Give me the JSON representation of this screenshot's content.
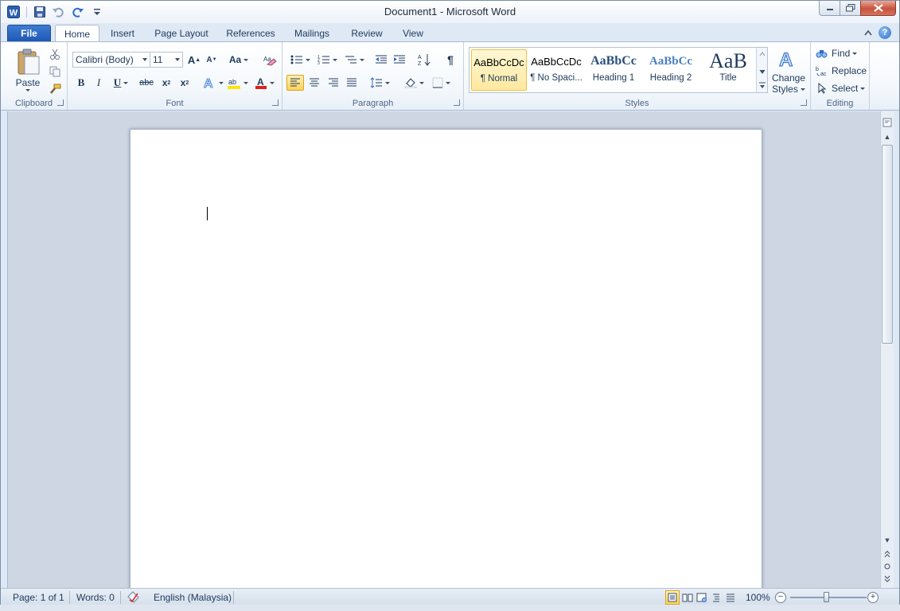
{
  "window": {
    "title": "Document1  -  Microsoft Word"
  },
  "qat": {
    "app_icon": "word-icon",
    "items": [
      "save-icon",
      "undo-icon",
      "redo-icon",
      "customize-icon"
    ]
  },
  "tabs": [
    "File",
    "Home",
    "Insert",
    "Page Layout",
    "References",
    "Mailings",
    "Review",
    "View"
  ],
  "ribbon": {
    "clipboard": {
      "label": "Clipboard",
      "paste": "Paste"
    },
    "font": {
      "label": "Font",
      "font_name": "Calibri (Body)",
      "font_size": "11",
      "change_case": "Aa"
    },
    "paragraph": {
      "label": "Paragraph"
    },
    "styles": {
      "label": "Styles",
      "items": [
        {
          "sample": "AaBbCcDc",
          "name": "¶ Normal"
        },
        {
          "sample": "AaBbCcDc",
          "name": "¶ No Spaci..."
        },
        {
          "sample": "AaBbCc",
          "name": "Heading 1"
        },
        {
          "sample": "AaBbCc",
          "name": "Heading 2"
        },
        {
          "sample": "AaB",
          "name": "Title"
        }
      ],
      "change_styles_line1": "Change",
      "change_styles_line2": "Styles"
    },
    "editing": {
      "label": "Editing",
      "find": "Find",
      "replace": "Replace",
      "select": "Select"
    }
  },
  "status": {
    "page": "Page: 1 of 1",
    "words": "Words: 0",
    "language": "English (Malaysia)",
    "zoom": "100%"
  },
  "colors": {
    "file_tab": "#2a64c0",
    "accent_underline_font": "#e0201b",
    "highlight": "#ffe600"
  }
}
